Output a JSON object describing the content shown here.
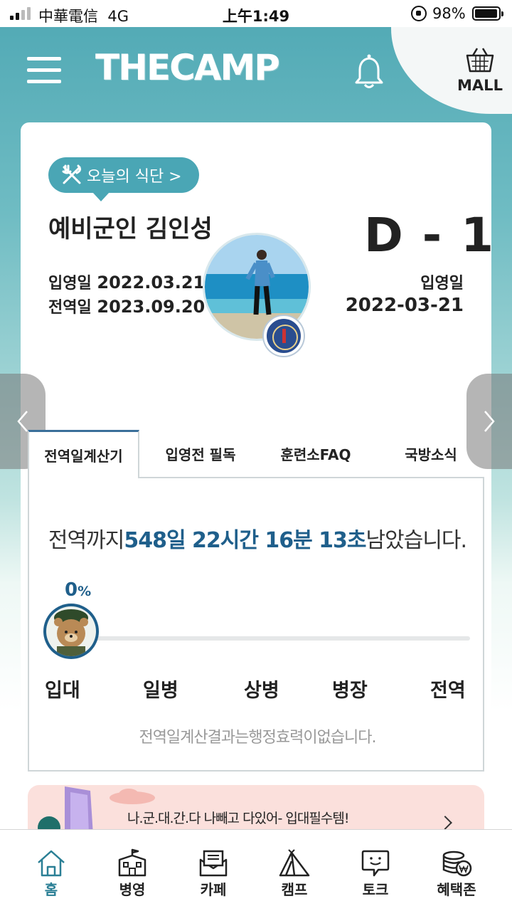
{
  "status_bar": {
    "carrier": "中華電信",
    "network": "4G",
    "time": "上午1:49",
    "battery": "98%"
  },
  "header": {
    "logo": "THECAMP",
    "mall_label": "MALL"
  },
  "profile": {
    "meal_button": "오늘의 식단 >",
    "name": "예비군인 김인성",
    "enlist_label": "입영일",
    "enlist_date": "2022.03.21",
    "discharge_label": "전역일",
    "discharge_date": "2023.09.20",
    "dday": "D - 1",
    "right_label": "입영일",
    "right_date": "2022-03-21"
  },
  "tabs": [
    {
      "label": "전역일계산기",
      "active": true
    },
    {
      "label": "입영전 필독",
      "active": false
    },
    {
      "label": "훈련소FAQ",
      "active": false
    },
    {
      "label": "국방소식",
      "active": false
    }
  ],
  "calculator": {
    "prefix": "전역까지",
    "remaining": "548일 22시간 16분 13초",
    "suffix": "남았습니다.",
    "percent": "0",
    "percent_unit": "%",
    "progress": 0,
    "ranks": [
      "입대",
      "일병",
      "상병",
      "병장",
      "전역"
    ],
    "disclaimer": "전역일계산결과는행정효력이없습니다."
  },
  "banner": {
    "text": "나.군.대.간.다 나빼고 다있어- 입대필수템!"
  },
  "bottom_nav": [
    {
      "label": "홈",
      "icon": "home-icon",
      "active": true
    },
    {
      "label": "병영",
      "icon": "barracks-icon",
      "active": false
    },
    {
      "label": "카페",
      "icon": "cafe-icon",
      "active": false
    },
    {
      "label": "캠프",
      "icon": "camp-icon",
      "active": false
    },
    {
      "label": "토크",
      "icon": "talk-icon",
      "active": false
    },
    {
      "label": "혜택존",
      "icon": "benefit-icon",
      "active": false
    }
  ],
  "colors": {
    "accent": "#4aa6b5",
    "highlight": "#1f5f8b",
    "active_nav": "#2a7f95"
  }
}
